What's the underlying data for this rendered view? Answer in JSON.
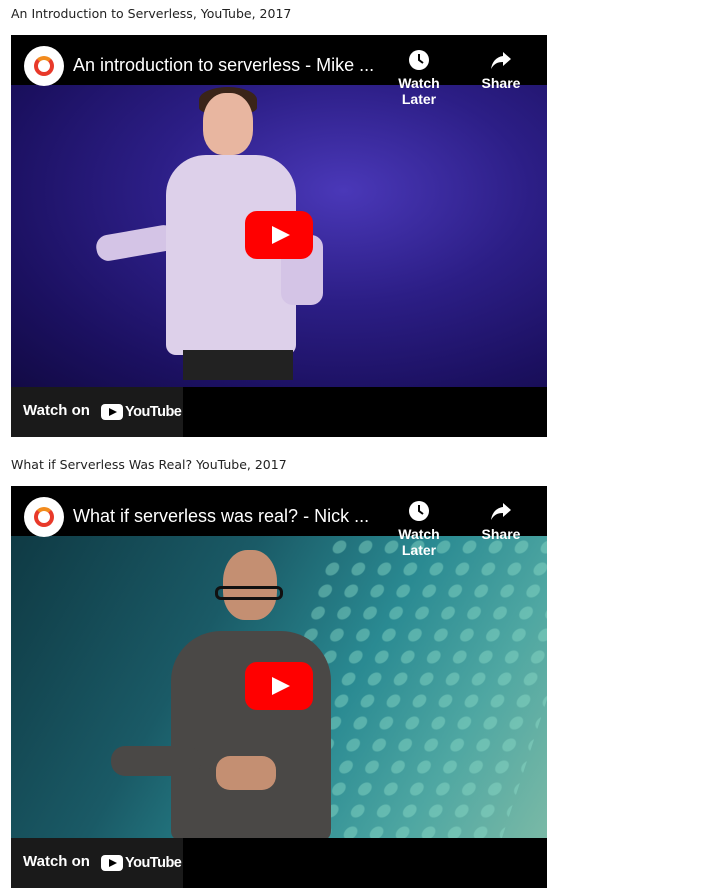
{
  "videos": [
    {
      "caption": "An Introduction to Serverless, YouTube, 2017",
      "title": "An introduction to serverless - Mike ...",
      "watch_later_label": "Watch Later",
      "share_label": "Share",
      "watch_on_label": "Watch on",
      "youtube_label": "YouTube"
    },
    {
      "caption": "What if Serverless Was Real? YouTube, 2017",
      "title": "What if serverless was real? - Nick ...",
      "watch_later_label": "Watch Later",
      "share_label": "Share",
      "watch_on_label": "Watch on",
      "youtube_label": "YouTube"
    }
  ],
  "icons": {
    "channel": "channel-logo-icon",
    "watch_later": "clock-icon",
    "share": "share-arrow-icon",
    "play": "play-icon",
    "youtube": "youtube-logo-icon"
  },
  "colors": {
    "play_button": "#ff0000",
    "logo_ring": "#e8392a"
  }
}
